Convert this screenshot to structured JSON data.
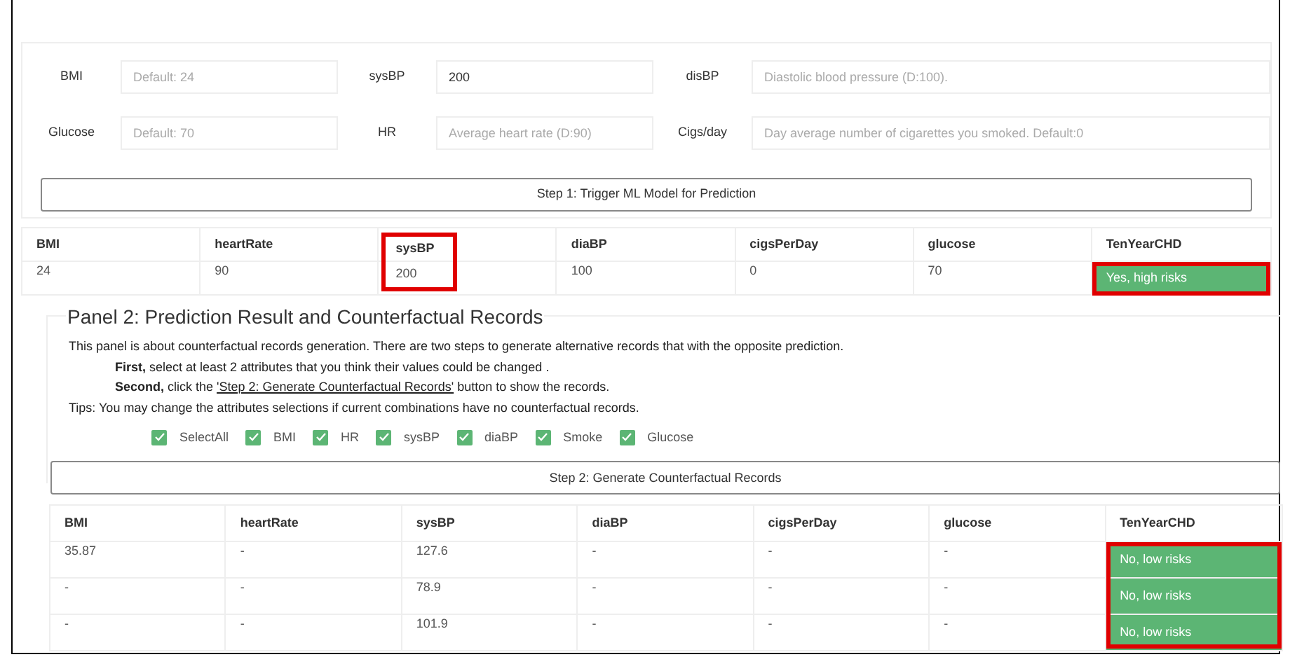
{
  "inputs": [
    {
      "label": "BMI",
      "placeholder": "Default: 24"
    },
    {
      "label": "sysBP",
      "value": "200"
    },
    {
      "label": "disBP",
      "placeholder": "Diastolic blood pressure (D:100)."
    },
    {
      "label": "Glucose",
      "placeholder": "Default: 70"
    },
    {
      "label": "HR",
      "placeholder": "Average heart rate (D:90)"
    },
    {
      "label": "Cigs/day",
      "placeholder": "Day average number of cigarettes you smoked. Default:0"
    }
  ],
  "step1_button": "Step 1: Trigger ML Model for Prediction",
  "prediction_table": {
    "columns": [
      {
        "label": "BMI",
        "highlighted": false
      },
      {
        "label": "heartRate",
        "highlighted": false
      },
      {
        "label": "sysBP",
        "highlighted": true
      },
      {
        "label": "diaBP",
        "highlighted": false
      },
      {
        "label": "cigsPerDay",
        "highlighted": false
      },
      {
        "label": "glucose",
        "highlighted": false
      },
      {
        "label": "TenYearCHD",
        "highlighted": false
      }
    ],
    "result_highlighted": true,
    "rows": [
      {
        "cells": [
          "24",
          "90",
          "200",
          "100",
          "0",
          "70"
        ],
        "result": "Yes, high risks"
      }
    ]
  },
  "panel2": {
    "title": "Panel 2: Prediction Result and Counterfactual Records",
    "intro": "This panel is about counterfactual records generation. There are two steps to generate alternative records that with the opposite prediction.",
    "first": "**First,** select at least 2 attributes that you think their values could be changed .",
    "second": {
      "lead": "**Second,** click the ",
      "link": "'Step 2: Generate Counterfactual Records'",
      "tail": " button to show the records."
    },
    "tips": "Tips: You may change the attributes selections if current combinations have no counterfactual records.",
    "checkboxes": [
      {
        "label": "SelectAll",
        "checked": true
      },
      {
        "label": "BMI",
        "checked": true
      },
      {
        "label": "HR",
        "checked": true
      },
      {
        "label": "sysBP",
        "checked": true
      },
      {
        "label": "diaBP",
        "checked": true
      },
      {
        "label": "Smoke",
        "checked": true
      },
      {
        "label": "Glucose",
        "checked": true
      }
    ],
    "step2_button": "Step 2: Generate Counterfactual Records"
  },
  "counterfactual_table": {
    "columns": [
      {
        "label": "BMI",
        "highlighted": false
      },
      {
        "label": "heartRate",
        "highlighted": false
      },
      {
        "label": "sysBP",
        "highlighted": false
      },
      {
        "label": "diaBP",
        "highlighted": false
      },
      {
        "label": "cigsPerDay",
        "highlighted": false
      },
      {
        "label": "glucose",
        "highlighted": false
      },
      {
        "label": "TenYearCHD",
        "highlighted": false
      }
    ],
    "result_highlighted": true,
    "rows": [
      {
        "cells": [
          "35.87",
          "-",
          "127.6",
          "-",
          "-",
          "-"
        ],
        "result": "No, low risks"
      },
      {
        "cells": [
          "-",
          "-",
          "78.9",
          "-",
          "-",
          "-"
        ],
        "result": "No, low risks"
      },
      {
        "cells": [
          "-",
          "-",
          "101.9",
          "-",
          "-",
          "-"
        ],
        "result": "No, low risks"
      }
    ]
  }
}
